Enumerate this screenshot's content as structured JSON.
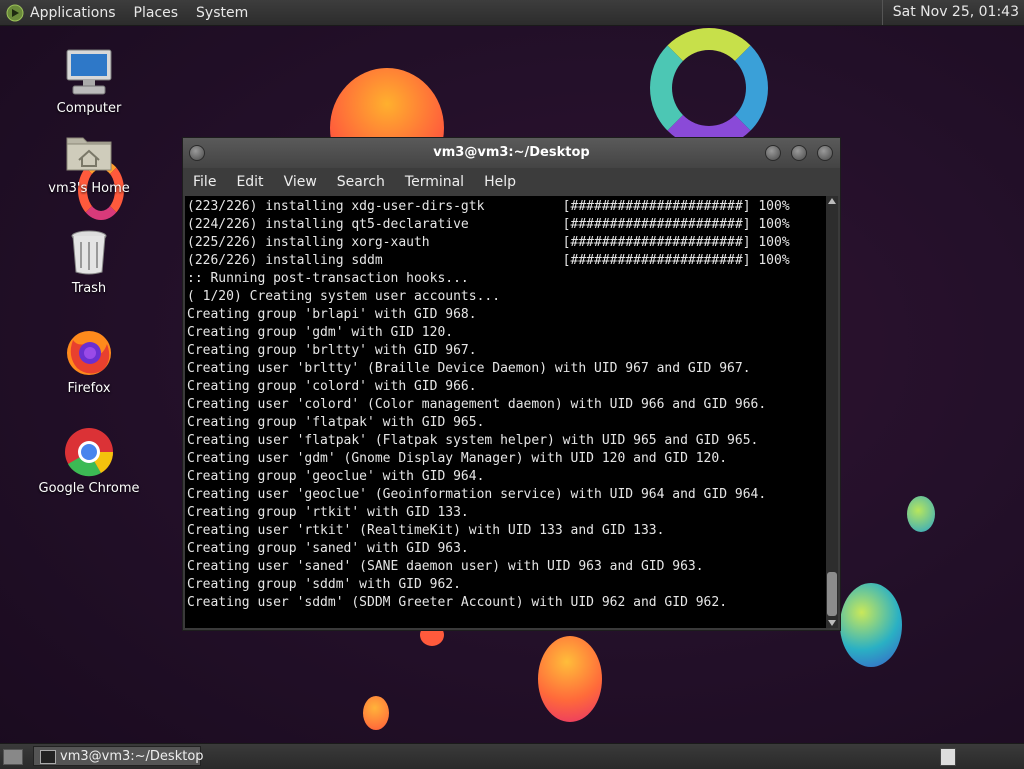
{
  "top_panel": {
    "menu": [
      "Applications",
      "Places",
      "System"
    ],
    "clock": "Sat Nov 25, 01:43"
  },
  "desktop_icons": [
    {
      "label": "Computer",
      "icon": "computer-icon"
    },
    {
      "label": "vm3's Home",
      "icon": "home-folder-icon"
    },
    {
      "label": "Trash",
      "icon": "trash-icon"
    },
    {
      "label": "Firefox",
      "icon": "firefox-icon"
    },
    {
      "label": "Google Chrome",
      "icon": "chrome-icon"
    }
  ],
  "terminal": {
    "title": "vm3@vm3:~/Desktop",
    "menu": [
      "File",
      "Edit",
      "View",
      "Search",
      "Terminal",
      "Help"
    ],
    "lines": [
      "(223/226) installing xdg-user-dirs-gtk          [######################] 100%",
      "(224/226) installing qt5-declarative            [######################] 100%",
      "(225/226) installing xorg-xauth                 [######################] 100%",
      "(226/226) installing sddm                       [######################] 100%",
      ":: Running post-transaction hooks...",
      "( 1/20) Creating system user accounts...",
      "Creating group 'brlapi' with GID 968.",
      "Creating group 'gdm' with GID 120.",
      "Creating group 'brltty' with GID 967.",
      "Creating user 'brltty' (Braille Device Daemon) with UID 967 and GID 967.",
      "Creating group 'colord' with GID 966.",
      "Creating user 'colord' (Color management daemon) with UID 966 and GID 966.",
      "Creating group 'flatpak' with GID 965.",
      "Creating user 'flatpak' (Flatpak system helper) with UID 965 and GID 965.",
      "Creating user 'gdm' (Gnome Display Manager) with UID 120 and GID 120.",
      "Creating group 'geoclue' with GID 964.",
      "Creating user 'geoclue' (Geoinformation service) with UID 964 and GID 964.",
      "Creating group 'rtkit' with GID 133.",
      "Creating user 'rtkit' (RealtimeKit) with UID 133 and GID 133.",
      "Creating group 'saned' with GID 963.",
      "Creating user 'saned' (SANE daemon user) with UID 963 and GID 963.",
      "Creating group 'sddm' with GID 962.",
      "Creating user 'sddm' (SDDM Greeter Account) with UID 962 and GID 962."
    ]
  },
  "taskbar": {
    "window_button": "vm3@vm3:~/Desktop"
  }
}
